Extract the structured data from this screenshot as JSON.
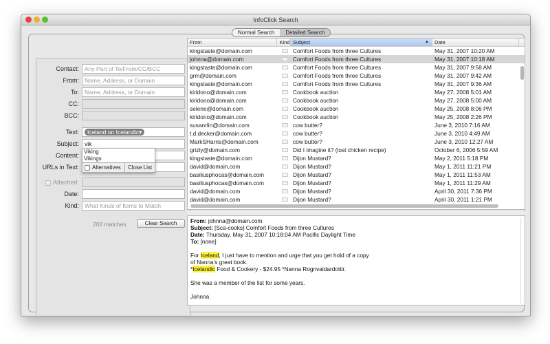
{
  "window": {
    "title": "InfoClick Search"
  },
  "tabs": [
    {
      "label": "Normal Search",
      "selected": false
    },
    {
      "label": "Detailed Search",
      "selected": true
    }
  ],
  "form": {
    "contact": {
      "label": "Contact:",
      "placeholder": "Any Part of To/From/CC/BCC"
    },
    "from": {
      "label": "From:",
      "placeholder": "Name, Address, or Domain"
    },
    "to": {
      "label": "To:",
      "placeholder": "Name, Address, or Domain"
    },
    "cc": {
      "label": "CC:"
    },
    "bcc": {
      "label": "BCC:"
    },
    "text": {
      "label": "Text:",
      "token": "Iceland on Icelandic▾"
    },
    "subject": {
      "label": "Subject:",
      "value": "vik"
    },
    "content": {
      "label": "Content:"
    },
    "urls": {
      "label": "URLs in Text:"
    },
    "attached": {
      "label": "Attached:"
    },
    "date": {
      "label": "Date:"
    },
    "kind": {
      "label": "Kind:",
      "placeholder": "What Kinds of Items to Match"
    },
    "matches": "202 matches",
    "clear_button": "Clear Search"
  },
  "autocomplete": {
    "options": [
      "Viking",
      "Vikings"
    ],
    "alternatives": "Alternatives",
    "close": "Close List"
  },
  "table": {
    "columns": [
      "From",
      "Kind",
      "Subject",
      "Date"
    ],
    "rows": [
      [
        "kingstaste@domain.com",
        "Comfort Foods from three Cultures",
        "May 31, 2007 10:20 AM"
      ],
      [
        "johnna@domain.com",
        "Comfort Foods from three Cultures",
        "May 31, 2007 10:18 AM"
      ],
      [
        "kingstaste@domain.com",
        "Comfort Foods from three Cultures",
        "May 31, 2007 9:58 AM"
      ],
      [
        "grm@domain.com",
        "Comfort Foods from three Cultures",
        "May 31, 2007 9:42 AM"
      ],
      [
        "kingstaste@domain.com",
        "Comfort Foods from three Cultures",
        "May 31, 2007 9:36 AM"
      ],
      [
        "kiridono@domain.com",
        "Cookbook auction",
        "May 27, 2008 5:01 AM"
      ],
      [
        "kiridono@domain.com",
        "Cookbook auction",
        "May 27, 2008 5:00 AM"
      ],
      [
        "selene@domain.com",
        "Cookbook auction",
        "May 25, 2008 8:06 PM"
      ],
      [
        "kiridono@domain.com",
        "Cookbook auction",
        "May 25, 2008 2:26 PM"
      ],
      [
        "susanrlin@domain.com",
        "cow butter?",
        "June 3, 2010 7:16 AM"
      ],
      [
        "t.d.decker@domain.com",
        "cow butter?",
        "June 3, 2010 4:49 AM"
      ],
      [
        "MarkSHarris@domain.com",
        "cow butter?",
        "June 3, 2010 12:27 AM"
      ],
      [
        "grizly@domain.com",
        "Did I imagine it? (lost chicken recipe)",
        "October 6, 2006 5:59 AM"
      ],
      [
        "kingstaste@domain.com",
        "Dijon Mustard?",
        "May 2, 2011 5:18 PM"
      ],
      [
        "david@domain.com",
        "Dijon Mustard?",
        "May 1, 2011 11:21 PM"
      ],
      [
        "basiliusphocas@domain.com",
        "Dijon Mustard?",
        "May 1, 2011 11:53 AM"
      ],
      [
        "basiliusphocas@domain.com",
        "Dijon Mustard?",
        "May 1, 2011 11:29 AM"
      ],
      [
        "david@domain.com",
        "Dijon Mustard?",
        "April 30, 2011 7:36 PM"
      ],
      [
        "david@domain.com",
        "Dijon Mustard?",
        "April 30, 2011 1:21 PM"
      ]
    ],
    "selected_index": 1
  },
  "preview": {
    "from_label": "From:",
    "from": " johnna@domain.com",
    "subject_label": "Subject:",
    "subject": " [Sca-cooks] Comfort Foods from three Cultures",
    "date_label": "Date:",
    "date": " Thursday, May 31, 2007 10:18:04 AM Pacific Daylight Time",
    "to_label": "To:",
    "to": " [none]",
    "p1_pre": "For ",
    "p1_hl": "Iceland",
    "p1_post": ", I just have to mention and urge that you get hold of a copy",
    "p2": "of Nanna's great book.",
    "p3_pre": "*",
    "p3_hl": "Icelandic",
    "p3_post": " Food & Cookery - $24.95  *Nanna Rognvaldardottir.",
    "p4": "She was a member of the list for some years.",
    "p5": "Johnna"
  }
}
